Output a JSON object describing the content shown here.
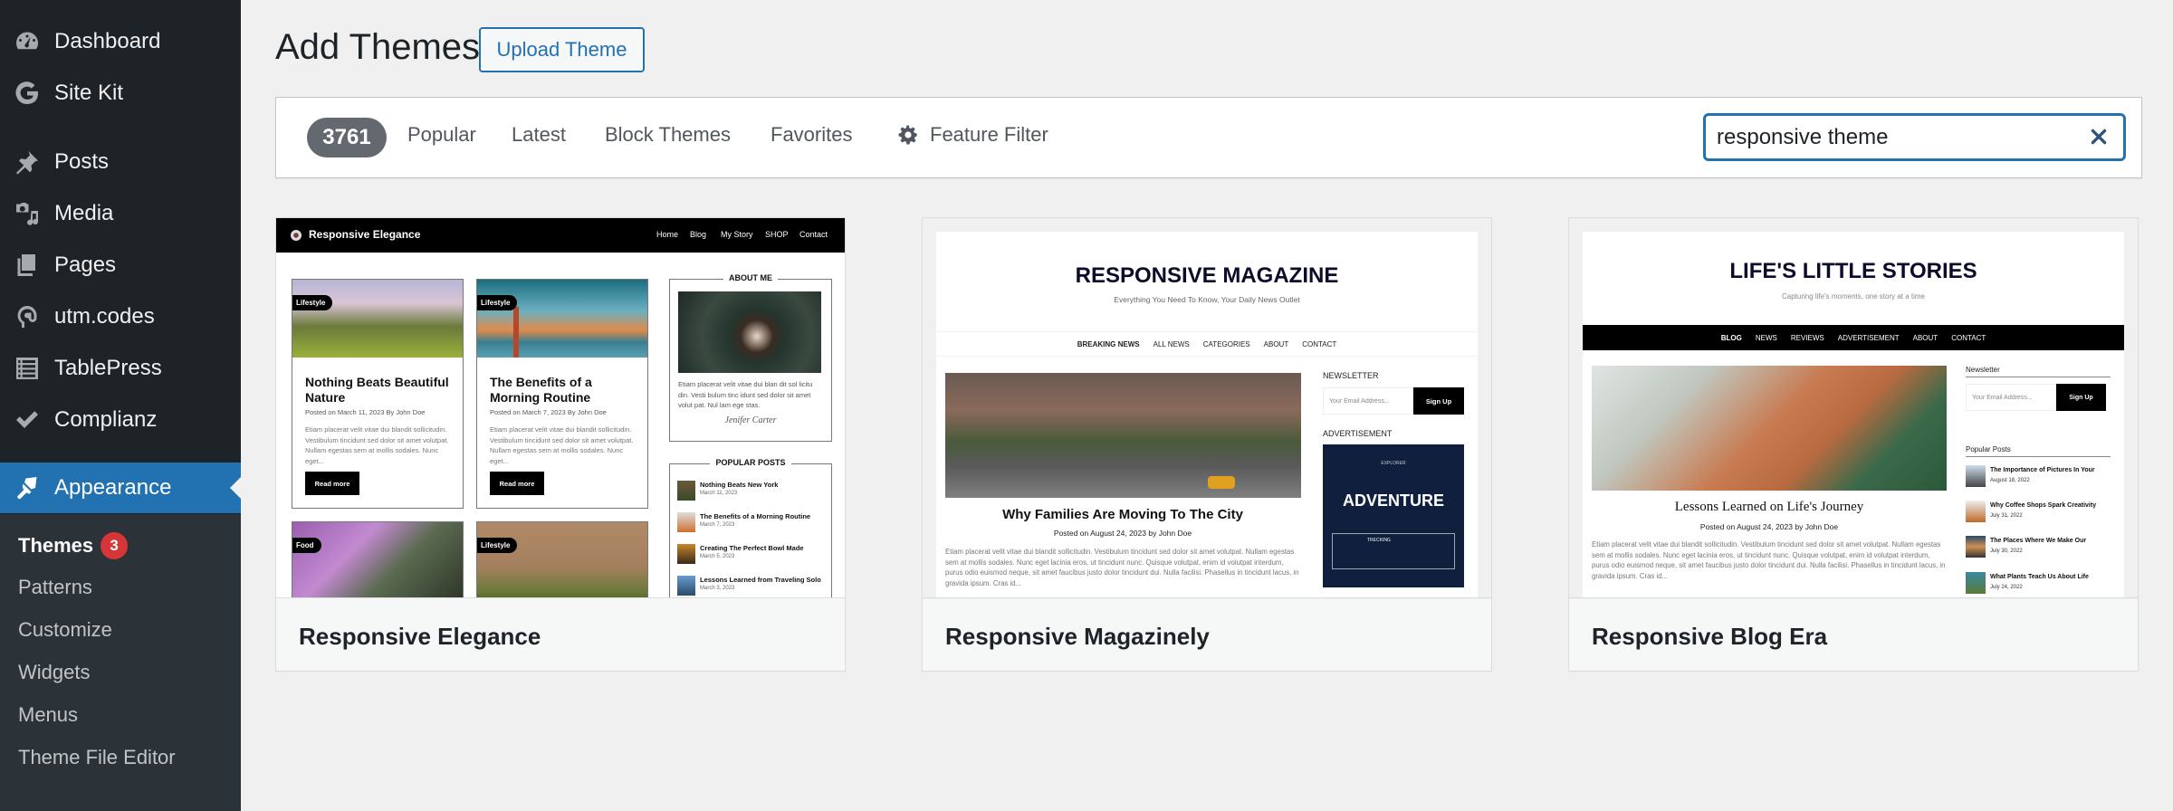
{
  "sidebar": {
    "items": [
      {
        "label": "Dashboard",
        "icon": "dashboard-icon"
      },
      {
        "label": "Site Kit",
        "icon": "google-g-icon"
      },
      {
        "label": "Posts",
        "icon": "pushpin-icon"
      },
      {
        "label": "Media",
        "icon": "media-icon"
      },
      {
        "label": "Pages",
        "icon": "pages-icon"
      },
      {
        "label": "utm.codes",
        "icon": "at-link-icon"
      },
      {
        "label": "TablePress",
        "icon": "table-list-icon"
      },
      {
        "label": "Complianz",
        "icon": "checkmark-icon"
      },
      {
        "label": "Appearance",
        "icon": "paintbrush-icon",
        "active": true
      }
    ],
    "submenu": [
      {
        "label": "Themes",
        "badge": "3",
        "current": true
      },
      {
        "label": "Patterns"
      },
      {
        "label": "Customize"
      },
      {
        "label": "Widgets"
      },
      {
        "label": "Menus"
      },
      {
        "label": "Theme File Editor"
      }
    ]
  },
  "header": {
    "title": "Add Themes",
    "upload_label": "Upload Theme"
  },
  "filter_bar": {
    "count": "3761",
    "links": [
      "Popular",
      "Latest",
      "Block Themes",
      "Favorites"
    ],
    "feature_filter_label": "Feature Filter",
    "search_value": "responsive theme"
  },
  "themes": [
    {
      "name": "Responsive Elegance",
      "preview": {
        "brand": "Responsive Elegance",
        "nav": [
          "Home",
          "Blog",
          "My Story",
          "SHOP",
          "Contact"
        ],
        "posts": [
          {
            "tag": "Lifestyle",
            "title": "Nothing Beats Beautiful Nature",
            "meta": "Posted on  March 11, 2023  By John Doe",
            "excerpt": "Etiam placerat velit vitae dui blandit sollicitudin. Vestibulum tincidunt sed dolor sit amet volutpat. Nullam egestas sem at mollis sodales. Nunc eget...",
            "button": "Read more"
          },
          {
            "tag": "Lifestyle",
            "title": "The Benefits of a Morning Routine",
            "meta": "Posted on  March 7, 2023  By John Doe",
            "excerpt": "Etiam placerat velit vitae dui blandit sollicitudin. Vestibulum tincidunt sed dolor sit amet volutpat. Nullam egestas sem at mollis sodales. Nunc eget...",
            "button": "Read more"
          },
          {
            "tag": "Food"
          },
          {
            "tag": "Lifestyle"
          }
        ],
        "about_title": "ABOUT ME",
        "about_text": "Etiam placerat velit vitae dui blan dit sol licitu din. Vesti bulum tinc idunt sed dolor sit amet volut pat. Nul lam ege stas.",
        "signature": "Jenifer Carter",
        "popular_title": "POPULAR POSTS",
        "popular": [
          {
            "title": "Nothing Beats New York",
            "date": "March 11, 2023"
          },
          {
            "title": "The Benefits of a Morning Routine",
            "date": "March 7, 2023"
          },
          {
            "title": "Creating The Perfect Bowl Made",
            "date": "March 5, 2023"
          },
          {
            "title": "Lessons Learned from Traveling Solo",
            "date": "March 3, 2023"
          }
        ]
      }
    },
    {
      "name": "Responsive Magazinely",
      "preview": {
        "site_title": "RESPONSIVE MAGAZINE",
        "tagline": "Everything You Need To Know, Your Daily News Outlet",
        "nav": [
          "BREAKING NEWS",
          "ALL NEWS",
          "CATEGORIES",
          "ABOUT",
          "CONTACT"
        ],
        "post_title": "Why Families Are Moving To The City",
        "post_meta": "Posted on August 24, 2023 by John Doe",
        "post_excerpt": "Etiam placerat velit vitae dui blandit sollicitudin. Vestibulum tincidunt sed dolor sit amet volutpat. Nullam egestas sem at mollis sodales. Nunc eget lacinia eros, ut tincidunt nunc. Quisque volutpat, enim id volutpat interdum, purus odio euismod neque, sit amet faucibus justo dolor tincidunt dui. Nulla facilisi. Phasellus in tincidunt lacus, in gravida ipsum. Cras id...",
        "newsletter_label": "NEWSLETTER",
        "email_placeholder": "Your Email Address...",
        "signup_label": "Sign Up",
        "ad_label": "ADVERTISEMENT",
        "ad_headline": "ADVENTURE",
        "ad_brand": "EXPLORER",
        "ad_box_title": "TRECKING"
      }
    },
    {
      "name": "Responsive Blog Era",
      "preview": {
        "site_title": "LIFE'S LITTLE STORIES",
        "tagline": "Capturing life's moments, one story at a time",
        "nav": [
          "BLOG",
          "NEWS",
          "REVIEWS",
          "ADVERTISEMENT",
          "ABOUT",
          "CONTACT"
        ],
        "post_title": "Lessons Learned on Life's Journey",
        "post_meta": "Posted on August 24, 2023 by John Doe",
        "post_excerpt": "Etiam placerat velit vitae dui blandit sollicitudin. Vestibulum tincidunt sed dolor sit amet volutpat. Nullam egestas sem at mollis sodales. Nunc eget lacinia eros, ut tincidunt nunc. Quisque volutpat, enim id volutpat interdum, purus odio euismod neque, sit amet faucibus justo dolor tincidunt dui. Nulla facilisi. Phasellus in tincidunt lacus, in gravida ipsum. Cras id...",
        "newsletter_label": "Newsletter",
        "email_placeholder": "Your Email Address...",
        "signup_label": "Sign Up",
        "popular_label": "Popular Posts",
        "popular": [
          {
            "title": "The Importance of Pictures In Your",
            "date": "August 18, 2022"
          },
          {
            "title": "Why Coffee Shops Spark Creativity",
            "date": "July 31, 2022"
          },
          {
            "title": "The Places Where We Make Our",
            "date": "July 30, 2022"
          },
          {
            "title": "What Plants Teach Us About Life",
            "date": "July 24, 2022"
          }
        ]
      }
    }
  ],
  "colors": {
    "sidebar_bg": "#1d2327",
    "submenu_bg": "#2c3338",
    "accent": "#2271b1",
    "badge": "#d63638",
    "page_bg": "#f0f0f1"
  }
}
